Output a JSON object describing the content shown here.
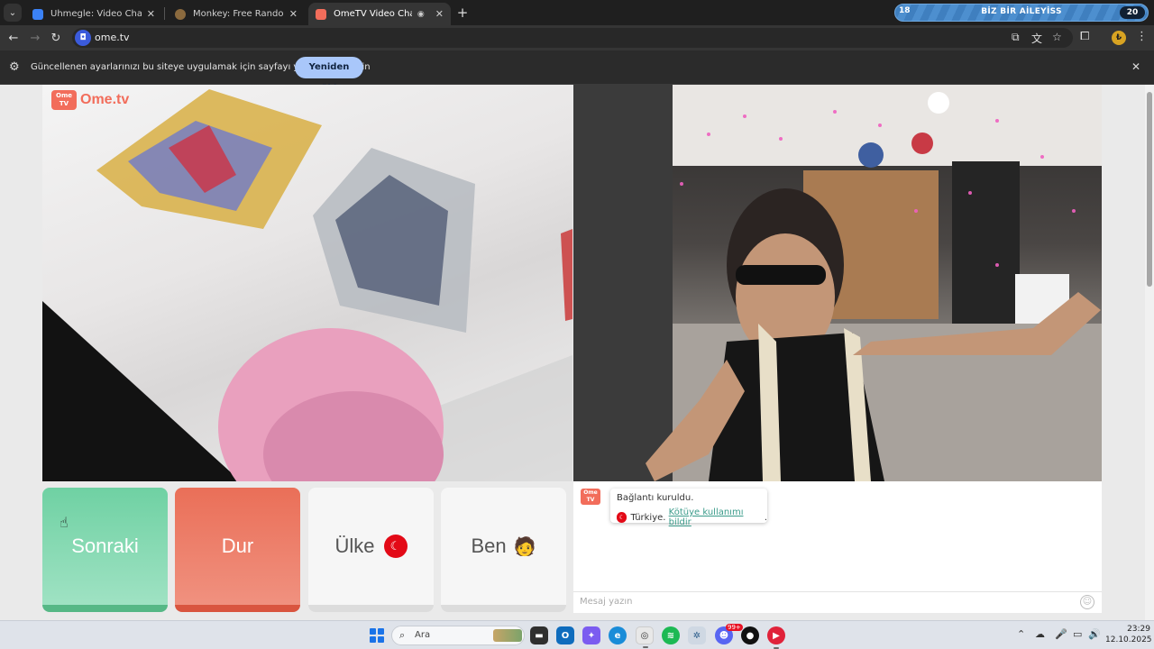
{
  "browser": {
    "tabs": [
      {
        "title": "Uhmegle: Video Chat | Omegle",
        "active": false,
        "favicon_color": "#3b82f6"
      },
      {
        "title": "Monkey: Free Random Video C",
        "active": false,
        "favicon_color": "#8b6a3e"
      },
      {
        "title": "OmeTV Video Chat — Ome",
        "active": true,
        "favicon_color": "#f26d5b"
      }
    ],
    "promo": {
      "left_number": "18",
      "text": "BİZ BİR AİLEYİSS",
      "right_number": "20"
    },
    "url": "ome.tv",
    "infobar": {
      "message": "Güncellenen ayarlarınızı bu siteye uygulamak için sayfayı yeniden yükleyin",
      "button": "Yeniden Yükle"
    }
  },
  "site": {
    "logo_text": "Ome.tv",
    "logo_badge": "Ome TV",
    "buttons": {
      "next": "Sonraki",
      "stop": "Dur",
      "country": "Ülke",
      "me": "Ben"
    },
    "chat": {
      "line1": "Bağlantı kuruldu.",
      "country": "Türkiye.",
      "report_link": "Kötüye kullanımı bildir",
      "period": ".",
      "placeholder": "Mesaj yazın"
    }
  },
  "taskbar": {
    "search_text": "Ara",
    "time": "23:29",
    "date": "12.10.2025",
    "badge_count": "99+"
  },
  "colors": {
    "brand": "#f26d5b",
    "next": "#6fd1a3",
    "stop": "#ea6f58",
    "link": "#3a9b8a"
  }
}
